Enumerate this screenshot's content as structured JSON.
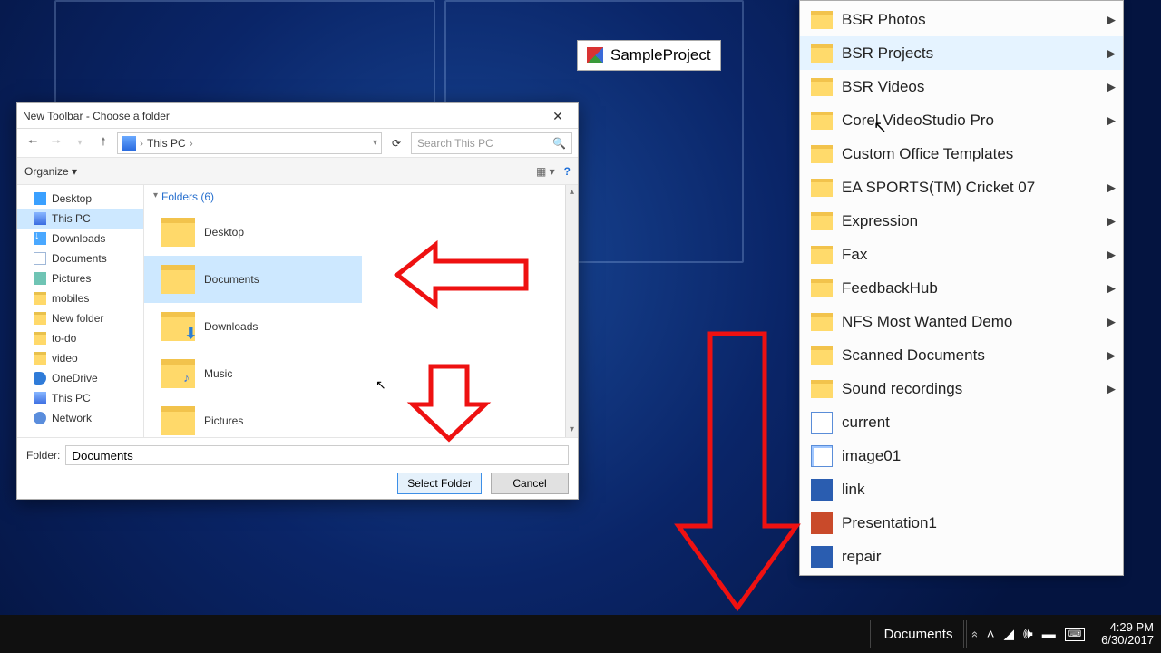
{
  "dialog": {
    "title": "New Toolbar - Choose a folder",
    "path_current": "This PC",
    "search_placeholder": "Search This PC",
    "organize_label": "Organize",
    "help_tooltip": "Help",
    "folders_header": "Folders (6)",
    "folder_field_label": "Folder:",
    "folder_field_value": "Documents",
    "select_label": "Select Folder",
    "cancel_label": "Cancel",
    "nav": [
      {
        "label": "Desktop",
        "icon": "desktop"
      },
      {
        "label": "This PC",
        "icon": "pc",
        "selected": true
      },
      {
        "label": "Downloads",
        "icon": "down"
      },
      {
        "label": "Documents",
        "icon": "doc"
      },
      {
        "label": "Pictures",
        "icon": "pics"
      },
      {
        "label": "mobiles",
        "icon": "folder"
      },
      {
        "label": "New folder",
        "icon": "folder"
      },
      {
        "label": "to-do",
        "icon": "folder"
      },
      {
        "label": "video",
        "icon": "folder"
      },
      {
        "label": "OneDrive",
        "icon": "onedr"
      },
      {
        "label": "This PC",
        "icon": "pc"
      },
      {
        "label": "Network",
        "icon": "network"
      }
    ],
    "items": [
      {
        "label": "Desktop"
      },
      {
        "label": "Documents",
        "selected": true
      },
      {
        "label": "Downloads",
        "overlay": "down"
      },
      {
        "label": "Music",
        "overlay": "note"
      },
      {
        "label": "Pictures"
      }
    ]
  },
  "flyout": {
    "label": "SampleProject"
  },
  "popup": {
    "items": [
      {
        "label": "BSR Photos",
        "icon": "folder",
        "submenu": true
      },
      {
        "label": "BSR Projects",
        "icon": "folder",
        "submenu": true,
        "highlighted": true
      },
      {
        "label": "BSR Videos",
        "icon": "folder",
        "submenu": true
      },
      {
        "label": "Corel VideoStudio Pro",
        "icon": "folder",
        "submenu": true
      },
      {
        "label": "Custom Office Templates",
        "icon": "folder"
      },
      {
        "label": "EA SPORTS(TM) Cricket 07",
        "icon": "folder",
        "submenu": true
      },
      {
        "label": "Expression",
        "icon": "folder",
        "submenu": true
      },
      {
        "label": "Fax",
        "icon": "folder",
        "submenu": true
      },
      {
        "label": "FeedbackHub",
        "icon": "folder",
        "submenu": true
      },
      {
        "label": "NFS Most Wanted Demo",
        "icon": "folder",
        "submenu": true
      },
      {
        "label": "Scanned Documents",
        "icon": "folder",
        "submenu": true
      },
      {
        "label": "Sound recordings",
        "icon": "folder",
        "submenu": true
      },
      {
        "label": "current",
        "icon": "blue"
      },
      {
        "label": "image01",
        "icon": "pic"
      },
      {
        "label": "link",
        "icon": "word"
      },
      {
        "label": "Presentation1",
        "icon": "ppt"
      },
      {
        "label": "repair",
        "icon": "word"
      }
    ]
  },
  "taskbar": {
    "toolbar_label": "Documents",
    "clock_time": "4:29 PM",
    "clock_date": "6/30/2017"
  }
}
